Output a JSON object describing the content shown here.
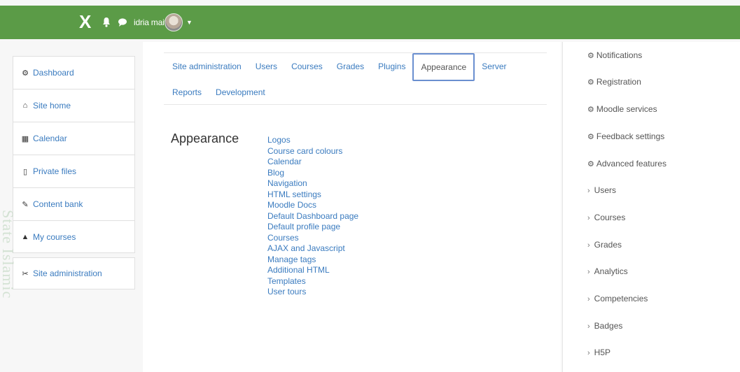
{
  "topbar": {
    "close_label": "X",
    "user_name": "idria maita"
  },
  "sidebar": {
    "items": [
      {
        "label": "Dashboard",
        "icon": "dashboard-icon",
        "glyph": "⚙"
      },
      {
        "label": "Site home",
        "icon": "home-icon",
        "glyph": "🏠"
      },
      {
        "label": "Calendar",
        "icon": "calendar-icon",
        "glyph": "▦"
      },
      {
        "label": "Private files",
        "icon": "file-icon",
        "glyph": "▯"
      },
      {
        "label": "Content bank",
        "icon": "brush-icon",
        "glyph": "✎"
      },
      {
        "label": "My courses",
        "icon": "graduation-cap-icon",
        "glyph": "🎓"
      },
      {
        "label": "Site administration",
        "icon": "wrench-icon",
        "glyph": "🔧"
      }
    ],
    "watermark": "State Islamic"
  },
  "tabs": {
    "row1": [
      "Site administration",
      "Users",
      "Courses",
      "Grades",
      "Plugins",
      "Appearance",
      "Server"
    ],
    "row2": [
      "Reports",
      "Development"
    ],
    "active": "Appearance"
  },
  "section": {
    "title": "Appearance",
    "links": [
      "Logos",
      "Course card colours",
      "Calendar",
      "Blog",
      "Navigation",
      "HTML settings",
      "Moodle Docs",
      "Default Dashboard page",
      "Default profile page",
      "Courses",
      "AJAX and Javascript",
      "Manage tags",
      "Additional HTML",
      "Templates",
      "User tours"
    ]
  },
  "right_panel": {
    "settings": [
      "Notifications",
      "Registration",
      "Moodle services",
      "Feedback settings",
      "Advanced features"
    ],
    "categories": [
      "Users",
      "Courses",
      "Grades",
      "Analytics",
      "Competencies",
      "Badges",
      "H5P"
    ]
  }
}
